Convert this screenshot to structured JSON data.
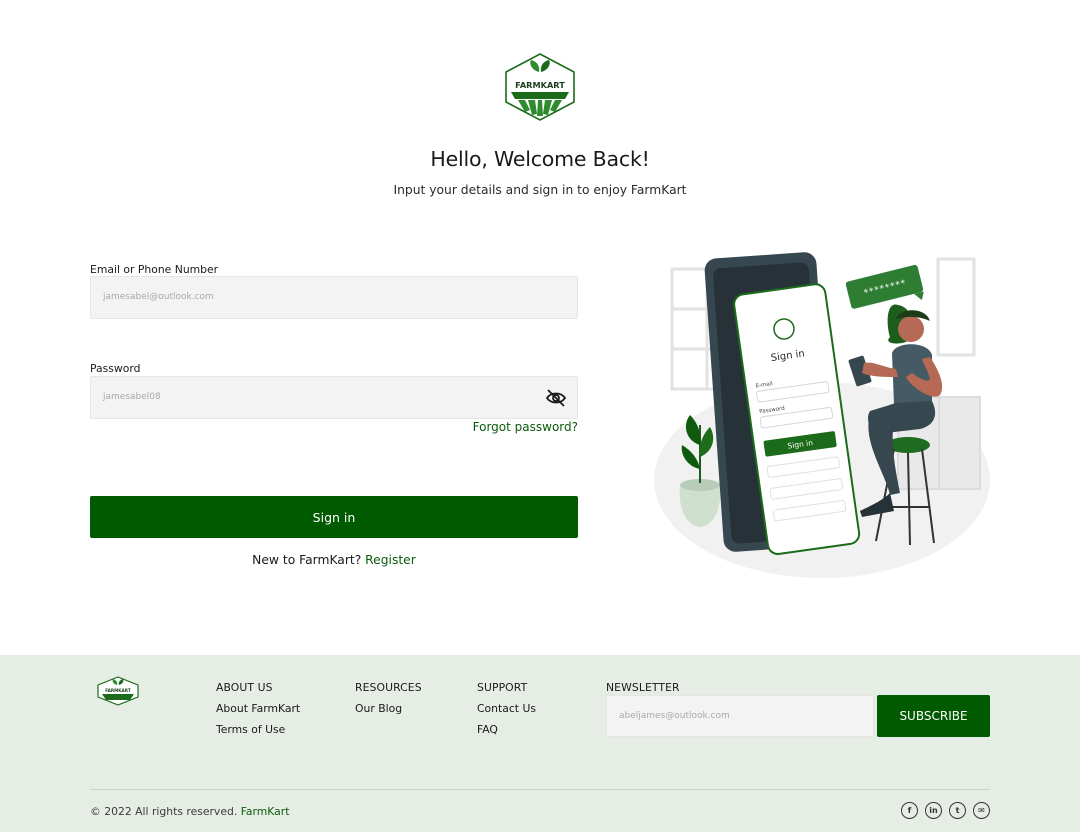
{
  "brand": {
    "logo_text": "FARMKART",
    "accent": "#005a00",
    "link_color": "#0b5a0b"
  },
  "header": {
    "title": "Hello, Welcome Back!",
    "subtitle": "Input your details and sign in to enjoy FarmKart"
  },
  "form": {
    "email_label": "Email or Phone Number",
    "email_placeholder": "jamesabel@outlook.com",
    "password_label": "Password",
    "password_placeholder": "jamesabel08",
    "toggle_icon": "eye-off-icon",
    "forgot": "Forgot password?",
    "signin": "Sign in",
    "register_prompt": "New to FarmKart?",
    "register_link": "Register"
  },
  "illustration": {
    "screen_title": "Sign in",
    "email_label": "E-mail",
    "password_label": "Password",
    "button": "Sign in",
    "bubble": "********"
  },
  "footer": {
    "about": {
      "heading": "ABOUT US",
      "links": [
        "About FarmKart",
        "Terms of Use"
      ]
    },
    "resources": {
      "heading": "RESOURCES",
      "links": [
        "Our Blog"
      ]
    },
    "support": {
      "heading": "SUPPORT",
      "links": [
        "Contact Us",
        "FAQ"
      ]
    },
    "newsletter": {
      "heading": "NEWSLETTER",
      "placeholder": "abeljames@outlook.com",
      "button": "SUBSCRIBE"
    },
    "copyright": "© 2022 All rights reserved.",
    "copyright_brand": "FarmKart",
    "social": [
      {
        "icon": "facebook-icon",
        "glyph": "f"
      },
      {
        "icon": "linkedin-icon",
        "glyph": "in"
      },
      {
        "icon": "twitter-icon",
        "glyph": "t"
      },
      {
        "icon": "mail-icon",
        "glyph": "✉"
      }
    ]
  }
}
